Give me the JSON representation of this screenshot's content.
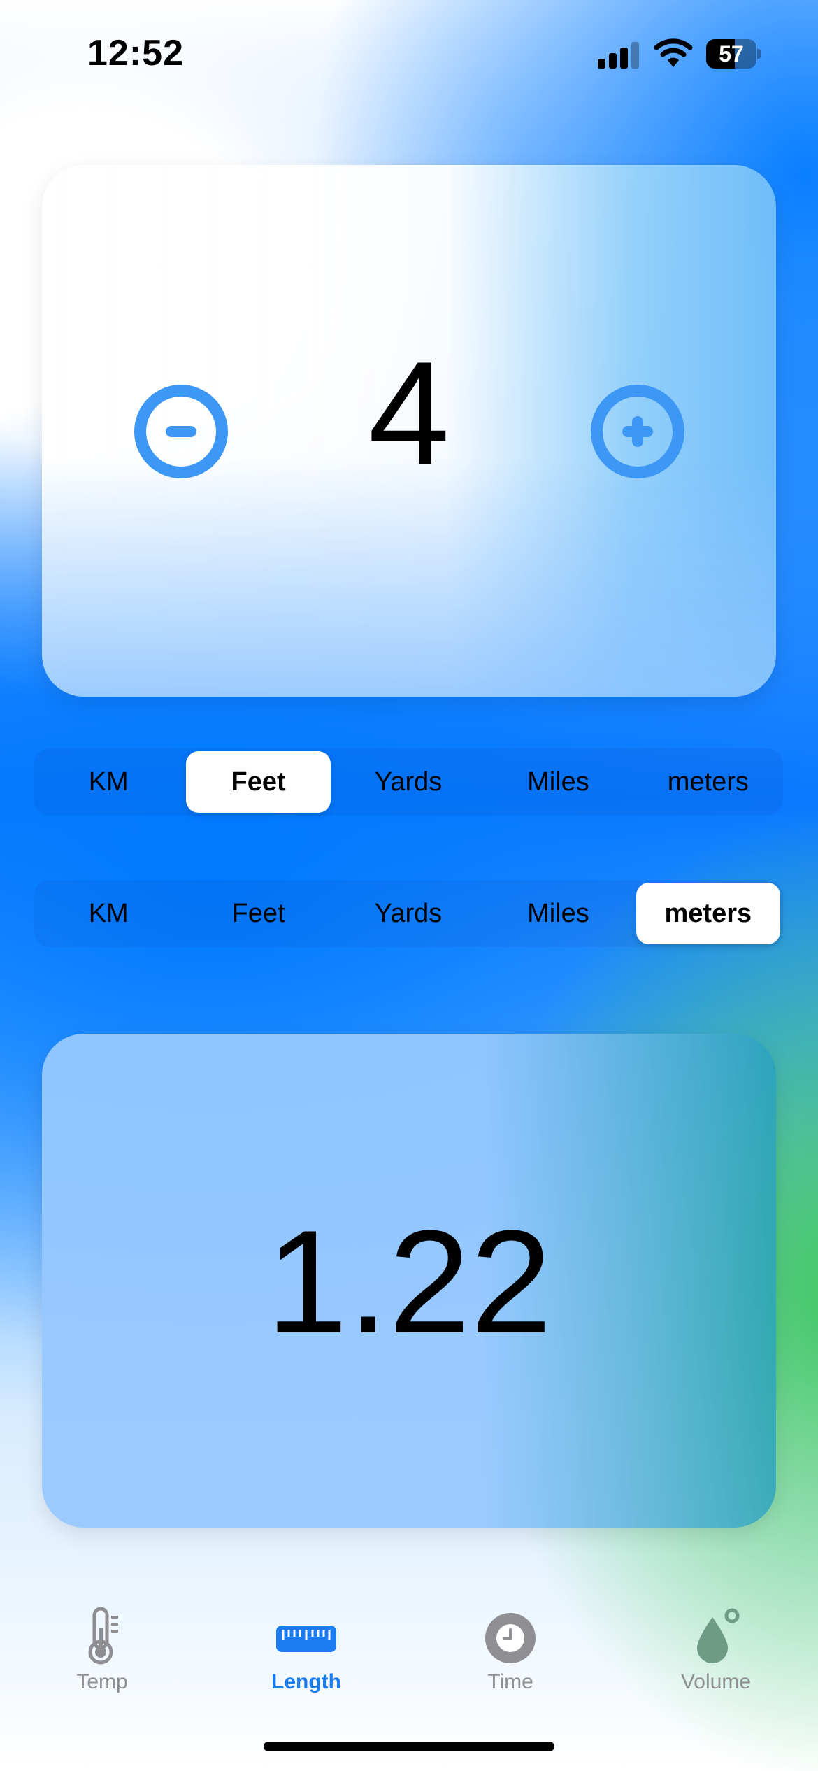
{
  "status_bar": {
    "time": "12:52",
    "battery_level": "57"
  },
  "converter": {
    "input_value": "4",
    "decrement_icon": "minus-circle-icon",
    "increment_icon": "plus-circle-icon",
    "result_value": "1.22"
  },
  "from_units": {
    "options": [
      "KM",
      "Feet",
      "Yards",
      "Miles",
      "meters"
    ],
    "selected": "Feet"
  },
  "to_units": {
    "options": [
      "KM",
      "Feet",
      "Yards",
      "Miles",
      "meters"
    ],
    "selected": "meters"
  },
  "tab_bar": {
    "tabs": [
      {
        "label": "Temp",
        "icon": "thermometer-icon"
      },
      {
        "label": "Length",
        "icon": "ruler-icon"
      },
      {
        "label": "Time",
        "icon": "clock-icon"
      },
      {
        "label": "Volume",
        "icon": "drop-icon"
      }
    ],
    "active": "Length"
  },
  "colors": {
    "accent": "#3d97f5",
    "active_tab": "#1a7cf0",
    "inactive_tab": "#8e8e93"
  }
}
